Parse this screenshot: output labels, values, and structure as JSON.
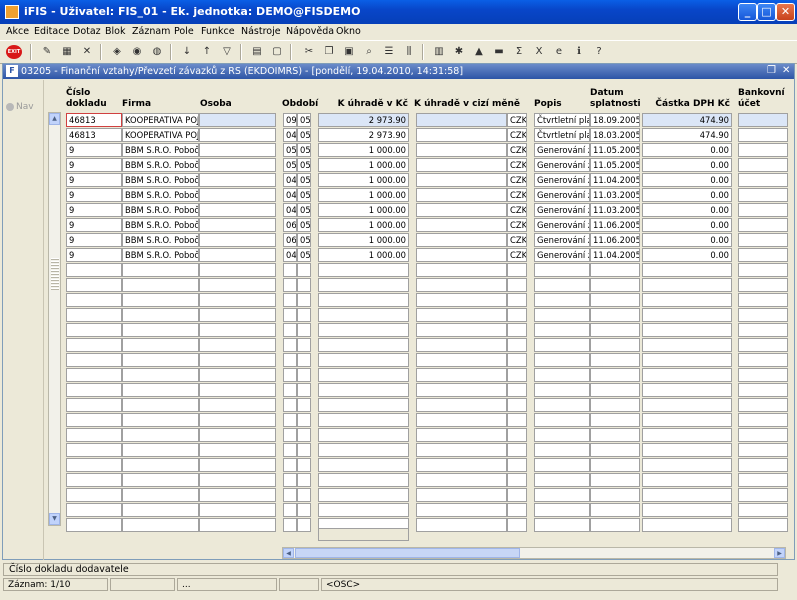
{
  "window": {
    "title": "iFIS - Uživatel: FIS_01 - Ek. jednotka: DEMO@FISDEMO",
    "minimize": "_",
    "maximize": "□",
    "close": "✕"
  },
  "menu": [
    "Akce",
    "Editace",
    "Dotaz",
    "Blok",
    "Záznam",
    "Pole",
    "Funkce",
    "Nástroje",
    "Nápověda",
    "Okno"
  ],
  "toolbar": {
    "exit_label": "EXIT"
  },
  "form": {
    "title": "03205 - Finanční vztahy/Převzetí závazků z RS (EKDOIMRS) - [pondělí, 19.04.2010, 14:31:58]",
    "icon_text": "F",
    "nav_label": "Nav"
  },
  "columns": {
    "cislo_dokladu": "Číslo\ndokladu",
    "firma": "Firma",
    "osoba": "Osoba",
    "obdobi": "Období",
    "k_uhrade_kc": "K úhradě v Kč",
    "k_uhrade_cm": "K úhradě v cizí měně",
    "popis": "Popis",
    "datum_splatnosti": "Datum\nsplatnosti",
    "castka_dph": "Částka DPH Kč",
    "bankovni_ucet": "Bankovní\núčet"
  },
  "rows": [
    {
      "doklad": "46813",
      "firma": "KOOPERATIVA POJ",
      "osoba": "",
      "obd1": "09",
      "obd2": "05",
      "kc": "2 973.90",
      "cm": "",
      "mena": "CZK",
      "popis": "Čtvrtletní platba",
      "datum": "18.09.2005",
      "dph": "474.90",
      "ucet": ""
    },
    {
      "doklad": "46813",
      "firma": "KOOPERATIVA POJ",
      "osoba": "",
      "obd1": "04",
      "obd2": "05",
      "kc": "2 973.90",
      "cm": "",
      "mena": "CZK",
      "popis": "Čtvrtletní platba",
      "datum": "18.03.2005",
      "dph": "474.90",
      "ucet": ""
    },
    {
      "doklad": "9",
      "firma": "BBM S.R.O. Pobočka",
      "osoba": "",
      "obd1": "05",
      "obd2": "05",
      "kc": "1 000.00",
      "cm": "",
      "mena": "CZK",
      "popis": "Generování zálohy",
      "datum": "11.05.2005",
      "dph": "0.00",
      "ucet": ""
    },
    {
      "doklad": "9",
      "firma": "BBM S.R.O. Pobočka",
      "osoba": "",
      "obd1": "05",
      "obd2": "05",
      "kc": "1 000.00",
      "cm": "",
      "mena": "CZK",
      "popis": "Generování zálohy",
      "datum": "11.05.2005",
      "dph": "0.00",
      "ucet": ""
    },
    {
      "doklad": "9",
      "firma": "BBM S.R.O. Pobočka",
      "osoba": "",
      "obd1": "04",
      "obd2": "05",
      "kc": "1 000.00",
      "cm": "",
      "mena": "CZK",
      "popis": "Generování zálohy",
      "datum": "11.04.2005",
      "dph": "0.00",
      "ucet": ""
    },
    {
      "doklad": "9",
      "firma": "BBM S.R.O. Pobočka",
      "osoba": "",
      "obd1": "04",
      "obd2": "05",
      "kc": "1 000.00",
      "cm": "",
      "mena": "CZK",
      "popis": "Generování zálohy",
      "datum": "11.03.2005",
      "dph": "0.00",
      "ucet": ""
    },
    {
      "doklad": "9",
      "firma": "BBM S.R.O. Pobočka",
      "osoba": "",
      "obd1": "04",
      "obd2": "05",
      "kc": "1 000.00",
      "cm": "",
      "mena": "CZK",
      "popis": "Generování zálohy",
      "datum": "11.03.2005",
      "dph": "0.00",
      "ucet": ""
    },
    {
      "doklad": "9",
      "firma": "BBM S.R.O. Pobočka",
      "osoba": "",
      "obd1": "06",
      "obd2": "05",
      "kc": "1 000.00",
      "cm": "",
      "mena": "CZK",
      "popis": "Generování zálohy",
      "datum": "11.06.2005",
      "dph": "0.00",
      "ucet": ""
    },
    {
      "doklad": "9",
      "firma": "BBM S.R.O. Pobočka",
      "osoba": "",
      "obd1": "06",
      "obd2": "05",
      "kc": "1 000.00",
      "cm": "",
      "mena": "CZK",
      "popis": "Generování zálohy",
      "datum": "11.06.2005",
      "dph": "0.00",
      "ucet": ""
    },
    {
      "doklad": "9",
      "firma": "BBM S.R.O. Pobočka",
      "osoba": "",
      "obd1": "04",
      "obd2": "05",
      "kc": "1 000.00",
      "cm": "",
      "mena": "CZK",
      "popis": "Generování zálohy",
      "datum": "11.04.2005",
      "dph": "0.00",
      "ucet": ""
    }
  ],
  "status": {
    "hint": "Číslo dokladu dodavatele",
    "record": "Záznam: 1/10",
    "seg2": "",
    "seg3": "...",
    "seg4": "",
    "osc": "<OSC>"
  }
}
